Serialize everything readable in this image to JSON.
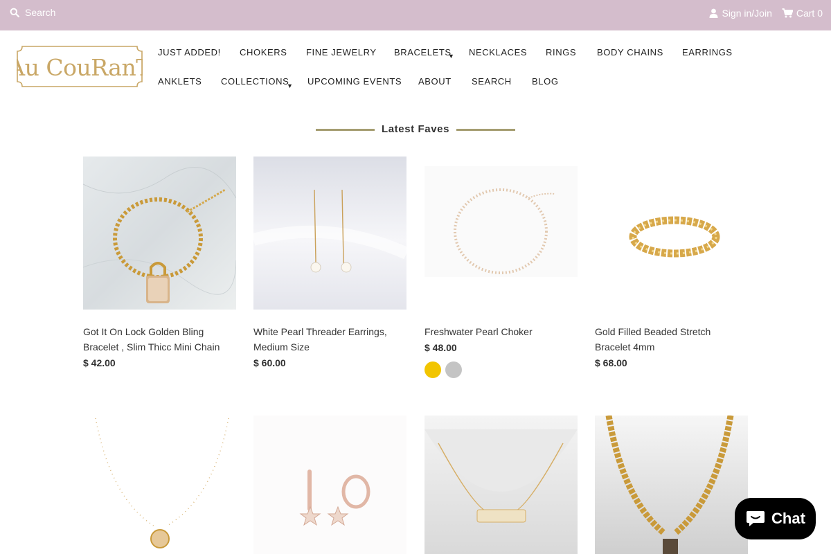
{
  "topbar": {
    "search_placeholder": "Search",
    "sign_in": "Sign in/Join",
    "cart": "Cart 0",
    "bg": "#d4bdcc"
  },
  "logo": {
    "text": "AU COURANT",
    "color": "#c9a766"
  },
  "nav": {
    "row1": [
      "JUST ADDED!",
      "CHOKERS",
      "FINE JEWELRY",
      "BRACELETS",
      "NECKLACES",
      "RINGS",
      "BODY CHAINS",
      "EARRINGS"
    ],
    "row2": [
      "ANKLETS",
      "COLLECTIONS",
      "UPCOMING EVENTS",
      "ABOUT",
      "SEARCH",
      "BLOG"
    ]
  },
  "section": {
    "title": "Latest Faves"
  },
  "products": [
    {
      "name": "Got It On Lock Golden Bling Bracelet , Slim Thicc Mini Chain",
      "price": "$ 42.00"
    },
    {
      "name": "White Pearl Threader Earrings, Medium Size",
      "price": "$ 60.00"
    },
    {
      "name": "Freshwater Pearl Choker",
      "price": "$ 48.00",
      "swatches": [
        "#f2c500",
        "#c4c4c4"
      ]
    },
    {
      "name": "Gold Filled Beaded Stretch Bracelet 4mm",
      "price": "$ 68.00"
    }
  ],
  "chat": {
    "label": "Chat"
  }
}
